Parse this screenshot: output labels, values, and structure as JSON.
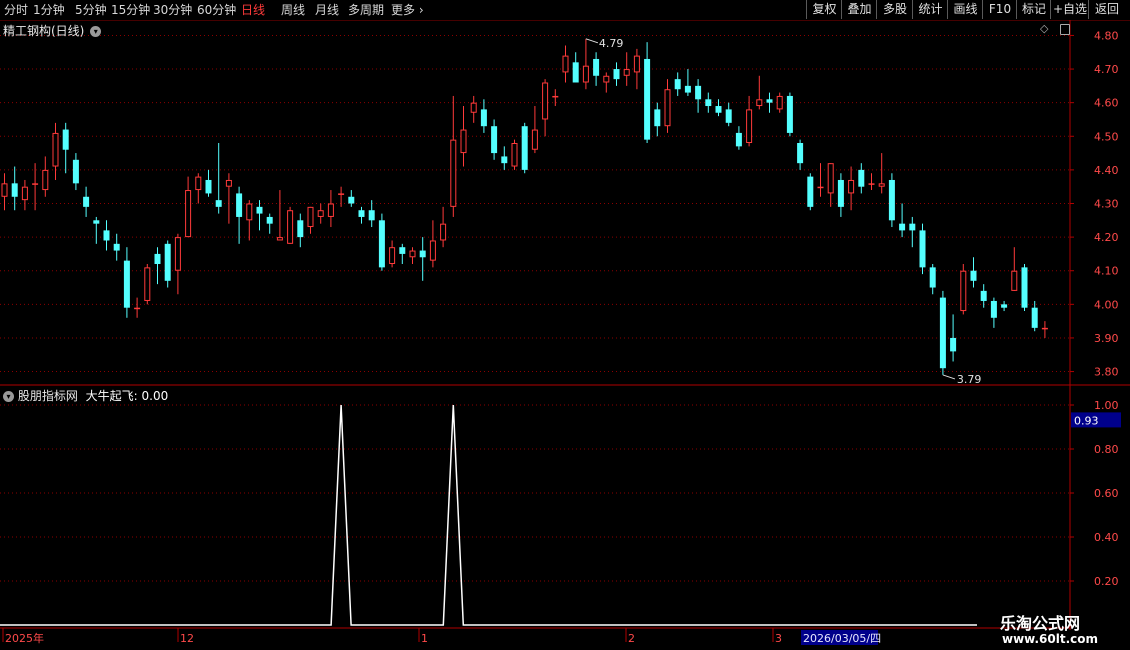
{
  "toolbar": {
    "periods": [
      "分时",
      "1分钟",
      "5分钟",
      "15分钟",
      "30分钟",
      "60分钟",
      "日线",
      "周线",
      "月线",
      "多周期",
      "更多"
    ],
    "active_period": "日线",
    "more_icon": "chevron-right-icon",
    "right_buttons": [
      "复权",
      "叠加",
      "多股",
      "统计",
      "画线",
      "F10",
      "标记",
      "+自选",
      "返回"
    ]
  },
  "main_chart": {
    "title": "精工钢构(日线)",
    "collapse_icon": "chevron-down-icon",
    "diamond_icon": "diamond-icon",
    "high_label": "4.79",
    "low_label": "3.79",
    "price_ticks": [
      "4.80",
      "4.70",
      "4.60",
      "4.50",
      "4.40",
      "4.30",
      "4.20",
      "4.10",
      "4.00",
      "3.90",
      "3.80"
    ]
  },
  "indicator": {
    "name": "股朋指标网",
    "line_label": "大牛起飞: 0.00",
    "current_value": "0.93",
    "ticks": [
      "1.00",
      "0.80",
      "0.60",
      "0.40",
      "0.20"
    ]
  },
  "date_axis": {
    "labels": [
      "2025年",
      "12",
      "1",
      "2",
      "3"
    ],
    "cursor_date": "2026/03/05/四"
  },
  "watermark": {
    "line1": "乐淘公式网",
    "line2": "www.60lt.com"
  },
  "colors": {
    "up": "#ff3a3a",
    "down": "#54ffff",
    "grid": "#8b0000",
    "axis_text": "#ff4a4a",
    "active_tab": "#ff3b3b",
    "indicator_line": "#ffffff",
    "cursor_box": "#00008b"
  },
  "chart_data": {
    "type": "candlestick",
    "price_range": [
      3.76,
      4.84
    ],
    "candles": [
      [
        4.32,
        4.36,
        4.39,
        4.28
      ],
      [
        4.36,
        4.32,
        4.41,
        4.28
      ],
      [
        4.31,
        4.35,
        4.37,
        4.28
      ],
      [
        4.36,
        4.36,
        4.42,
        4.28
      ],
      [
        4.34,
        4.4,
        4.44,
        4.32
      ],
      [
        4.41,
        4.51,
        4.54,
        4.37
      ],
      [
        4.52,
        4.46,
        4.54,
        4.39
      ],
      [
        4.43,
        4.36,
        4.45,
        4.34
      ],
      [
        4.32,
        4.29,
        4.35,
        4.26
      ],
      [
        4.25,
        4.24,
        4.26,
        4.18
      ],
      [
        4.22,
        4.19,
        4.25,
        4.16
      ],
      [
        4.18,
        4.16,
        4.21,
        4.13
      ],
      [
        4.13,
        3.99,
        4.17,
        3.96
      ],
      [
        3.99,
        3.99,
        4.02,
        3.96
      ],
      [
        4.01,
        4.11,
        4.12,
        4.0
      ],
      [
        4.15,
        4.12,
        4.17,
        4.06
      ],
      [
        4.18,
        4.07,
        4.19,
        4.05
      ],
      [
        4.1,
        4.2,
        4.21,
        4.03
      ],
      [
        4.2,
        4.34,
        4.38,
        4.2
      ],
      [
        4.34,
        4.38,
        4.39,
        4.3
      ],
      [
        4.37,
        4.33,
        4.4,
        4.32
      ],
      [
        4.31,
        4.29,
        4.48,
        4.27
      ],
      [
        4.35,
        4.37,
        4.39,
        4.24
      ],
      [
        4.33,
        4.26,
        4.35,
        4.18
      ],
      [
        4.25,
        4.3,
        4.31,
        4.19
      ],
      [
        4.29,
        4.27,
        4.31,
        4.22
      ],
      [
        4.26,
        4.24,
        4.27,
        4.21
      ],
      [
        4.19,
        4.2,
        4.34,
        4.2
      ],
      [
        4.18,
        4.28,
        4.29,
        4.18
      ],
      [
        4.25,
        4.2,
        4.27,
        4.17
      ],
      [
        4.23,
        4.29,
        4.29,
        4.21
      ],
      [
        4.26,
        4.28,
        4.3,
        4.24
      ],
      [
        4.26,
        4.3,
        4.34,
        4.23
      ],
      [
        4.33,
        4.33,
        4.35,
        4.29
      ],
      [
        4.32,
        4.3,
        4.34,
        4.29
      ],
      [
        4.28,
        4.26,
        4.29,
        4.24
      ],
      [
        4.28,
        4.25,
        4.31,
        4.23
      ],
      [
        4.25,
        4.11,
        4.27,
        4.1
      ],
      [
        4.12,
        4.17,
        4.19,
        4.11
      ],
      [
        4.17,
        4.15,
        4.18,
        4.12
      ],
      [
        4.14,
        4.16,
        4.17,
        4.12
      ],
      [
        4.16,
        4.14,
        4.2,
        4.07
      ],
      [
        4.13,
        4.19,
        4.25,
        4.11
      ],
      [
        4.19,
        4.24,
        4.29,
        4.17
      ],
      [
        4.29,
        4.49,
        4.62,
        4.26
      ],
      [
        4.45,
        4.52,
        4.59,
        4.41
      ],
      [
        4.57,
        4.6,
        4.62,
        4.54
      ],
      [
        4.58,
        4.53,
        4.61,
        4.51
      ],
      [
        4.53,
        4.45,
        4.55,
        4.43
      ],
      [
        4.44,
        4.42,
        4.47,
        4.4
      ],
      [
        4.41,
        4.48,
        4.49,
        4.4
      ],
      [
        4.53,
        4.4,
        4.54,
        4.39
      ],
      [
        4.46,
        4.52,
        4.59,
        4.45
      ],
      [
        4.55,
        4.66,
        4.67,
        4.5
      ],
      [
        4.62,
        4.62,
        4.64,
        4.59
      ],
      [
        4.69,
        4.74,
        4.77,
        4.66
      ],
      [
        4.72,
        4.66,
        4.75,
        4.66
      ],
      [
        4.66,
        4.71,
        4.79,
        4.64
      ],
      [
        4.73,
        4.68,
        4.75,
        4.65
      ],
      [
        4.66,
        4.68,
        4.69,
        4.63
      ],
      [
        4.7,
        4.67,
        4.72,
        4.65
      ],
      [
        4.68,
        4.7,
        4.75,
        4.65
      ],
      [
        4.69,
        4.74,
        4.76,
        4.64
      ],
      [
        4.73,
        4.49,
        4.78,
        4.48
      ],
      [
        4.58,
        4.53,
        4.6,
        4.5
      ],
      [
        4.53,
        4.64,
        4.67,
        4.51
      ],
      [
        4.67,
        4.64,
        4.69,
        4.62
      ],
      [
        4.65,
        4.63,
        4.7,
        4.62
      ],
      [
        4.65,
        4.61,
        4.67,
        4.57
      ],
      [
        4.61,
        4.59,
        4.63,
        4.57
      ],
      [
        4.59,
        4.57,
        4.61,
        4.56
      ],
      [
        4.58,
        4.54,
        4.6,
        4.53
      ],
      [
        4.51,
        4.47,
        4.53,
        4.46
      ],
      [
        4.48,
        4.58,
        4.62,
        4.47
      ],
      [
        4.59,
        4.61,
        4.68,
        4.58
      ],
      [
        4.61,
        4.6,
        4.63,
        4.57
      ],
      [
        4.58,
        4.62,
        4.63,
        4.57
      ],
      [
        4.62,
        4.51,
        4.63,
        4.5
      ],
      [
        4.48,
        4.42,
        4.49,
        4.4
      ],
      [
        4.38,
        4.29,
        4.39,
        4.28
      ],
      [
        4.35,
        4.35,
        4.42,
        4.32
      ],
      [
        4.33,
        4.42,
        4.42,
        4.29
      ],
      [
        4.37,
        4.29,
        4.39,
        4.26
      ],
      [
        4.33,
        4.37,
        4.41,
        4.28
      ],
      [
        4.4,
        4.35,
        4.42,
        4.33
      ],
      [
        4.36,
        4.36,
        4.39,
        4.34
      ],
      [
        4.35,
        4.36,
        4.45,
        4.33
      ],
      [
        4.37,
        4.25,
        4.39,
        4.23
      ],
      [
        4.24,
        4.22,
        4.3,
        4.2
      ],
      [
        4.24,
        4.22,
        4.26,
        4.17
      ],
      [
        4.22,
        4.11,
        4.24,
        4.09
      ],
      [
        4.11,
        4.05,
        4.12,
        4.03
      ],
      [
        4.02,
        3.81,
        4.04,
        3.79
      ],
      [
        3.9,
        3.86,
        3.97,
        3.83
      ],
      [
        3.98,
        4.1,
        4.12,
        3.97
      ],
      [
        4.1,
        4.07,
        4.14,
        4.05
      ],
      [
        4.04,
        4.01,
        4.06,
        3.99
      ],
      [
        4.01,
        3.96,
        4.02,
        3.93
      ],
      [
        4.0,
        3.99,
        4.01,
        3.98
      ],
      [
        4.04,
        4.1,
        4.17,
        4.04
      ],
      [
        4.11,
        3.99,
        4.12,
        3.98
      ],
      [
        3.99,
        3.93,
        4.01,
        3.92
      ],
      [
        3.93,
        3.93,
        3.95,
        3.9
      ]
    ],
    "indicator": {
      "name": "大牛起飞",
      "ylim": [
        0,
        1.0
      ],
      "spikes_at_index": [
        33,
        44
      ]
    }
  }
}
